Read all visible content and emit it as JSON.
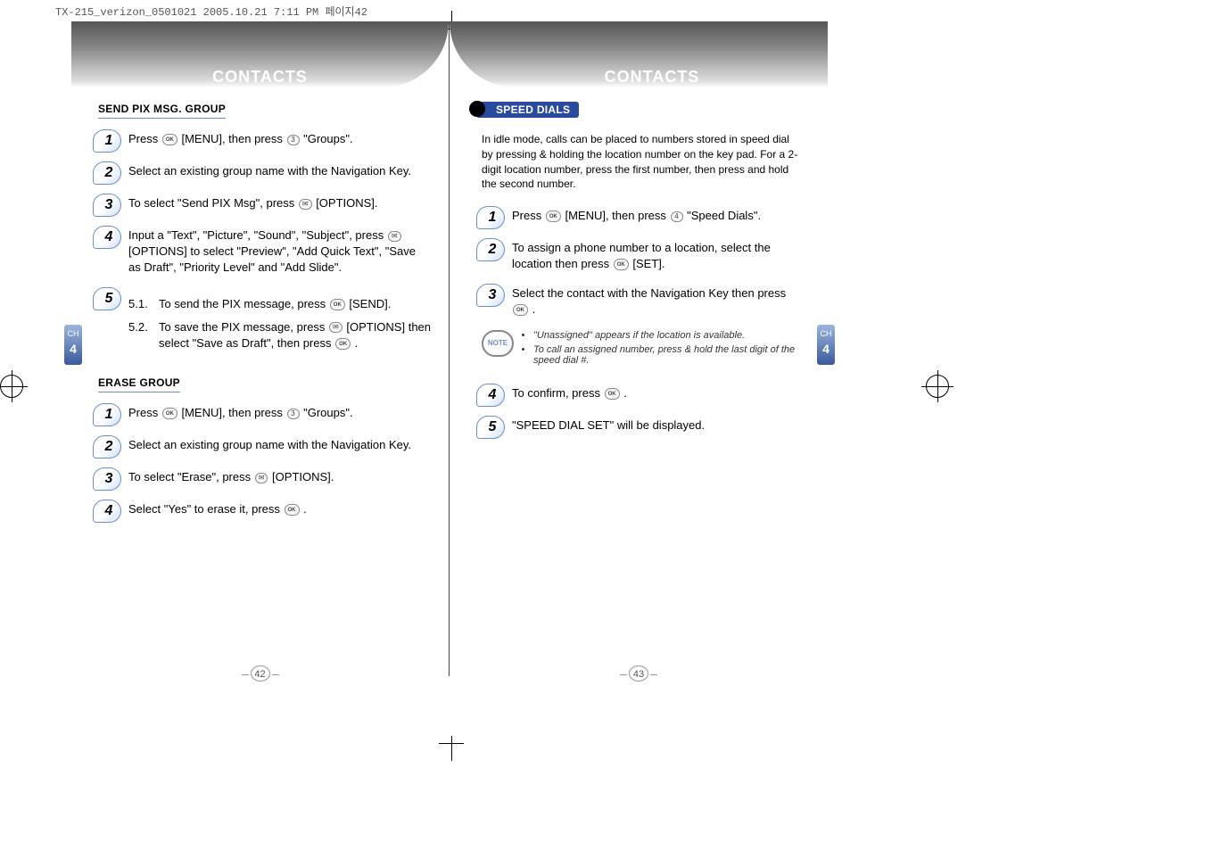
{
  "meta": {
    "source_line": "TX-215_verizon_0501021  2005.10.21  7:11 PM  페이지42"
  },
  "left_page": {
    "header": "CONTACTS",
    "chapter_label": "CH",
    "chapter_num": "4",
    "page_number": "42",
    "sections": [
      {
        "title": "SEND PIX MSG. GROUP",
        "steps": [
          {
            "n": "1",
            "text_before": "Press ",
            "key1": "OK",
            "text_mid": " [MENU], then press ",
            "key2": "3",
            "text_after": " \"Groups\"."
          },
          {
            "n": "2",
            "text": "Select an existing group name with the Navigation Key."
          },
          {
            "n": "3",
            "text_before": "To select \"Send PIX Msg\", press ",
            "key1": "cam",
            "text_after": " [OPTIONS]."
          },
          {
            "n": "4",
            "text_before": "Input a \"Text\", \"Picture\", \"Sound\", \"Subject\", press ",
            "key1": "cam",
            "text_after": " [OPTIONS] to select \"Preview\", \"Add Quick Text\", \"Save as Draft\", \"Priority Level\" and \"Add Slide\"."
          },
          {
            "n": "5",
            "subs": [
              {
                "sn": "5.1.",
                "text_before": "To send the PIX message, press ",
                "key1": "OK",
                "text_after": " [SEND]."
              },
              {
                "sn": "5.2.",
                "text_before": "To save the PIX message, press ",
                "key1": "cam",
                "text_mid": " [OPTIONS] then select \"Save as Draft\", then press ",
                "key2": "OK",
                "text_after": " ."
              }
            ]
          }
        ]
      },
      {
        "title": "ERASE GROUP",
        "steps": [
          {
            "n": "1",
            "text_before": "Press ",
            "key1": "OK",
            "text_mid": " [MENU], then press ",
            "key2": "3",
            "text_after": " \"Groups\"."
          },
          {
            "n": "2",
            "text": "Select an existing group name with the Navigation Key."
          },
          {
            "n": "3",
            "text_before": "To select \"Erase\", press ",
            "key1": "cam",
            "text_after": " [OPTIONS]."
          },
          {
            "n": "4",
            "text_before": "Select \"Yes\" to erase it, press ",
            "key1": "OK",
            "text_after": " ."
          }
        ]
      }
    ]
  },
  "right_page": {
    "header": "CONTACTS",
    "chapter_label": "CH",
    "chapter_num": "4",
    "page_number": "43",
    "section_pill": "SPEED DIALS",
    "intro": "In idle mode, calls can be placed to numbers stored in speed dial by pressing & holding the location number on the key pad. For a 2-digit location number, press the first number, then press and hold the second number.",
    "steps": [
      {
        "n": "1",
        "text_before": "Press ",
        "key1": "OK",
        "text_mid": " [MENU], then press ",
        "key2": "4",
        "text_after": " \"Speed Dials\"."
      },
      {
        "n": "2",
        "text_before": "To assign a phone number to a location, select the location then press ",
        "key1": "OK",
        "text_after": " [SET]."
      },
      {
        "n": "3",
        "text_before": "Select the contact with the Navigation Key then press ",
        "key1": "OK",
        "text_after": " ."
      }
    ],
    "note_label": "NOTE",
    "notes": [
      "\"Unassigned\" appears if the location is available.",
      "To call an assigned number, press & hold the last digit of the speed dial #."
    ],
    "steps_after": [
      {
        "n": "4",
        "text_before": "To confirm, press ",
        "key1": "OK",
        "text_after": " ."
      },
      {
        "n": "5",
        "text": "\"SPEED DIAL SET\" will be displayed."
      }
    ]
  }
}
